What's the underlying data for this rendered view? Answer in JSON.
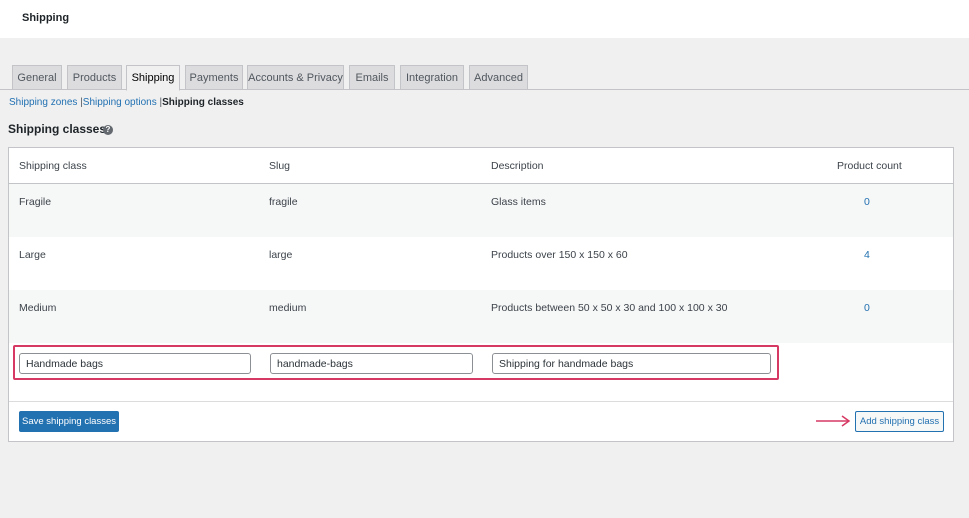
{
  "header": {
    "title": "Shipping"
  },
  "tabs": [
    {
      "label": "General",
      "active": false
    },
    {
      "label": "Products",
      "active": false
    },
    {
      "label": "Shipping",
      "active": true
    },
    {
      "label": "Payments",
      "active": false
    },
    {
      "label": "Accounts & Privacy",
      "active": false
    },
    {
      "label": "Emails",
      "active": false
    },
    {
      "label": "Integration",
      "active": false
    },
    {
      "label": "Advanced",
      "active": false
    }
  ],
  "subnav": {
    "zones": "Shipping zones",
    "sep1": "|",
    "options": "Shipping options",
    "sep2": "|",
    "current": "Shipping classes"
  },
  "section": {
    "title": "Shipping classes",
    "help_icon": "question-mark-icon"
  },
  "table": {
    "columns": [
      "Shipping class",
      "Slug",
      "Description",
      "Product count"
    ],
    "rows": [
      {
        "name": "Fragile",
        "slug": "fragile",
        "description": "Glass items",
        "count": "0"
      },
      {
        "name": "Large",
        "slug": "large",
        "description": "Products over 150 x 150 x 60",
        "count": "4"
      },
      {
        "name": "Medium",
        "slug": "medium",
        "description": "Products between 50 x 50 x 30 and 100 x 100 x 30",
        "count": "0"
      }
    ]
  },
  "new_class": {
    "name_value": "Handmade bags",
    "slug_value": "handmade-bags",
    "description_value": "Shipping for handmade bags"
  },
  "actions": {
    "save_label": "Save shipping classes",
    "add_label": "Add shipping class"
  },
  "colors": {
    "accent": "#2271b1",
    "highlight": "#d63964",
    "background": "#f0f0f1"
  }
}
